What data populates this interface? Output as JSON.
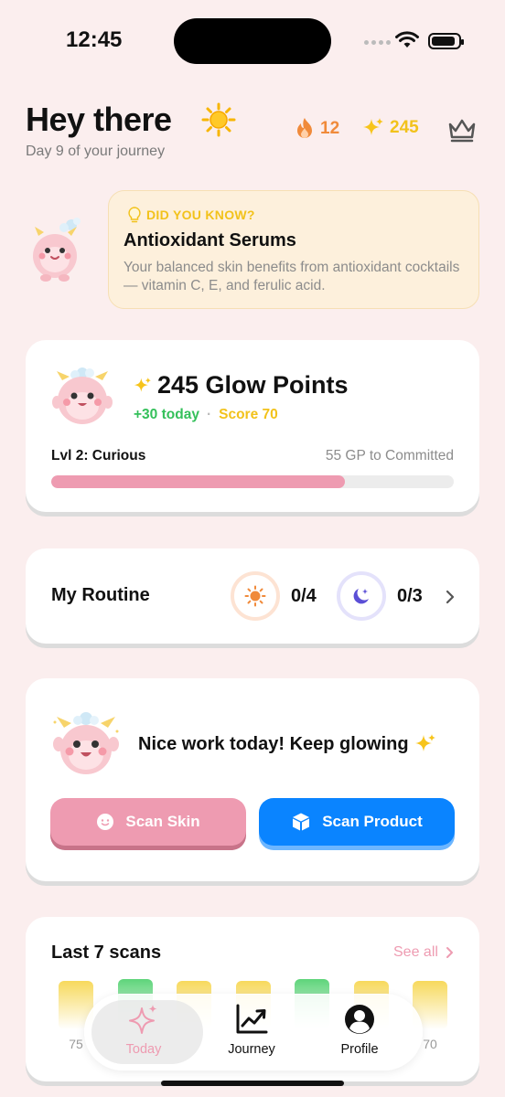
{
  "status_bar": {
    "time": "12:45"
  },
  "header": {
    "greeting": "Hey there",
    "greeting_emoji": "sun-emoji",
    "subtitle": "Day 9 of your journey",
    "streak": "12",
    "sparkles": "245"
  },
  "did_you_know": {
    "label": "DID YOU KNOW?",
    "title": "Antioxidant Serums",
    "body": "Your balanced skin benefits from antioxidant cocktails — vitamin C, E, and ferulic acid."
  },
  "points_card": {
    "title": "245 Glow Points",
    "today": "+30 today",
    "separator": "·",
    "score": "Score 70",
    "level": "Lvl 2: Curious",
    "to_next": "55 GP to Committed",
    "progress_fraction": 0.73
  },
  "routine": {
    "title": "My Routine",
    "morning": "0/4",
    "evening": "0/3"
  },
  "scan_card": {
    "message": "Nice work today! Keep glowing",
    "scan_skin": "Scan Skin",
    "scan_product": "Scan Product"
  },
  "last_scans": {
    "title": "Last 7 scans",
    "see_all": "See all",
    "bars": [
      {
        "label": "75",
        "color": "#f7d95c"
      },
      {
        "label": "",
        "color": "#5ed47a"
      },
      {
        "label": "",
        "color": "#f7d95c"
      },
      {
        "label": "",
        "color": "#f7d95c"
      },
      {
        "label": "",
        "color": "#5ed47a"
      },
      {
        "label": "",
        "color": "#f7d95c"
      },
      {
        "label": "70",
        "color": "#f7d95c"
      }
    ]
  },
  "tab_bar": {
    "today": "Today",
    "journey": "Journey",
    "profile": "Profile"
  },
  "colors": {
    "background": "#fbeeee",
    "pink": "#ee9bb1",
    "blue": "#0a84ff",
    "yellow": "#f2c21b",
    "green": "#34c05a",
    "orange": "#f08a3a"
  }
}
